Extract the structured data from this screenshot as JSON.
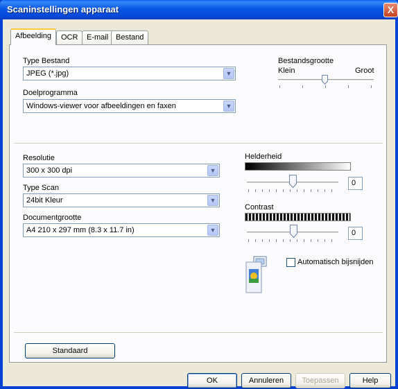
{
  "window": {
    "title": "Scaninstellingen apparaat",
    "close_label": "X"
  },
  "tabs": [
    {
      "label": "Afbeelding",
      "active": true
    },
    {
      "label": "OCR",
      "active": false
    },
    {
      "label": "E-mail",
      "active": false
    },
    {
      "label": "Bestand",
      "active": false
    }
  ],
  "file_type": {
    "label": "Type Bestand",
    "value": "JPEG (*.jpg)"
  },
  "target_app": {
    "label": "Doelprogramma",
    "value": "Windows-viewer voor afbeeldingen en faxen"
  },
  "file_size": {
    "label": "Bestandsgrootte",
    "min_label": "Klein",
    "max_label": "Groot",
    "level": 0.5
  },
  "resolution": {
    "label": "Resolutie",
    "value": "300 x 300 dpi"
  },
  "scan_type": {
    "label": "Type Scan",
    "value": "24bit Kleur"
  },
  "document_size": {
    "label": "Documentgrootte",
    "value": "A4 210 x 297 mm (8.3 x 11.7 in)"
  },
  "brightness": {
    "label": "Helderheid",
    "value": "0",
    "level": 0.5
  },
  "contrast": {
    "label": "Contrast",
    "value": "0",
    "level": 0.5
  },
  "auto_crop": {
    "label": "Automatisch bijsnijden",
    "checked": false
  },
  "buttons": {
    "default_label": "Standaard",
    "ok_label": "OK",
    "cancel_label": "Annuleren",
    "apply_label": "Toepassen",
    "help_label": "Help"
  },
  "colors": {
    "title_bar": "#0a56e6",
    "window_bg": "#ece9d8",
    "active_tab_accent": "#ffc83c"
  }
}
